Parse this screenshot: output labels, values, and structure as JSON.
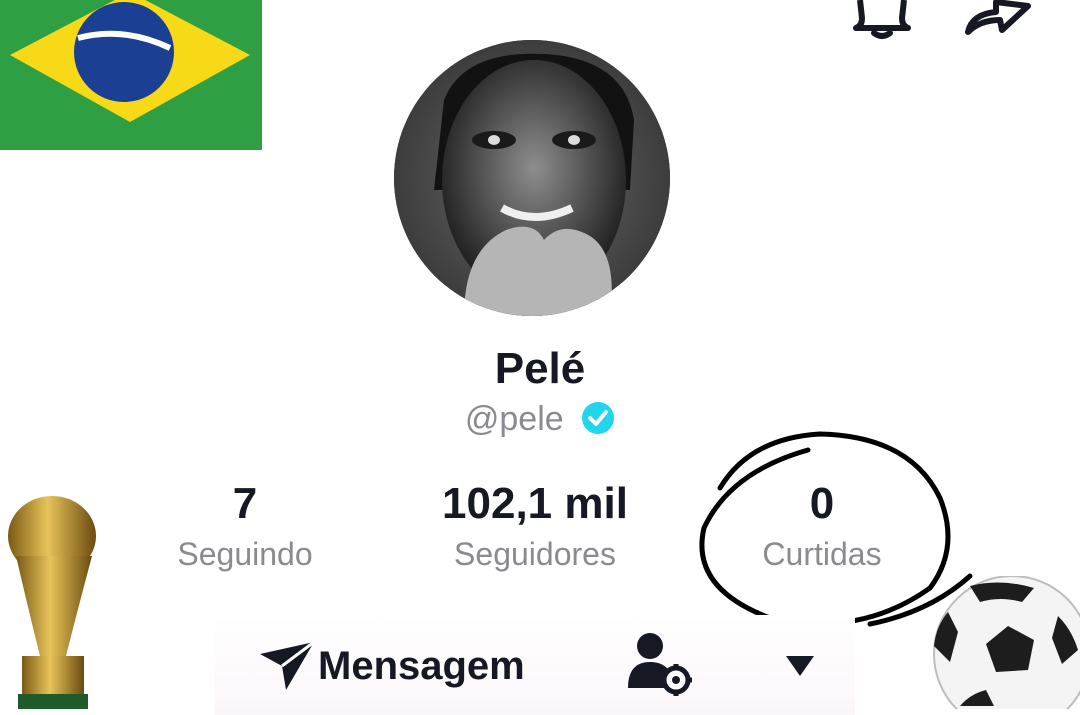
{
  "profile": {
    "display_name": "Pelé",
    "username": "@pele",
    "verified": true
  },
  "stats": [
    {
      "value": "7",
      "label": "Seguindo"
    },
    {
      "value": "102,1 mil",
      "label": "Seguidores"
    },
    {
      "value": "0",
      "label": "Curtidas"
    }
  ],
  "actions": {
    "message_label": "Mensagem"
  },
  "icons": {
    "top_right": [
      "bell-icon",
      "share-icon"
    ],
    "action_bar": [
      "send-icon",
      "add-friend-icon",
      "dropdown-triangle-icon"
    ],
    "stickers": [
      "brazil-flag",
      "world-cup-trophy",
      "soccer-ball"
    ]
  },
  "colors": {
    "text_primary": "#161823",
    "text_secondary": "#8a8b91",
    "verified_badge": "#20d5ec",
    "flag_green": "#2ea043",
    "flag_yellow": "#f7d917",
    "flag_blue": "#1a3f93"
  }
}
